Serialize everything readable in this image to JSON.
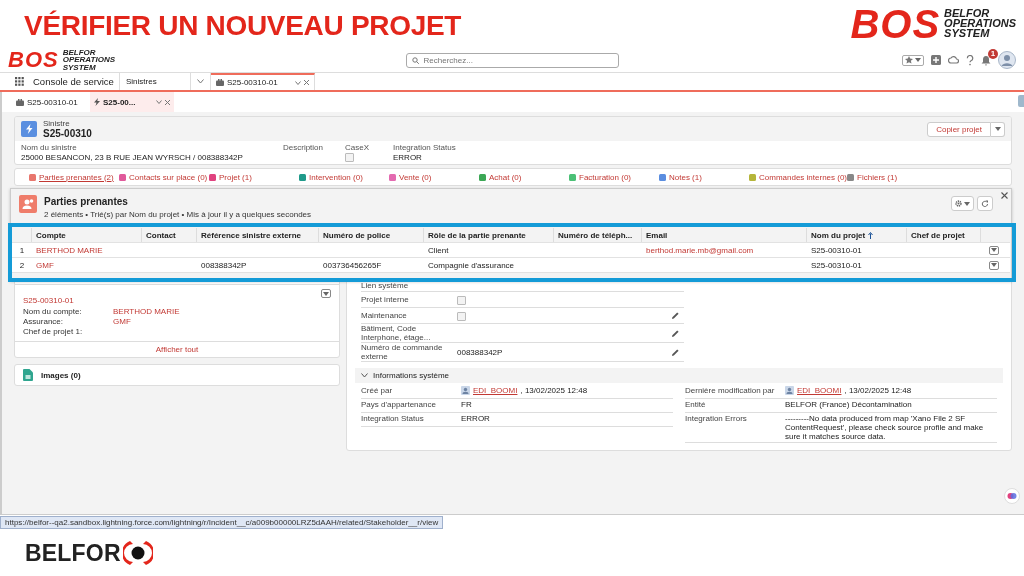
{
  "slide": {
    "title": "VÉRIFIER UN NOUVEAU PROJET",
    "logo": {
      "mark": "BOS",
      "tagline": "BELFOR OPERATIONS SYSTEM"
    },
    "footer_logo": "BELFOR"
  },
  "app": {
    "logo": {
      "mark": "BOS",
      "tagline": "BELFOR OPERATIONS SYSTEM"
    },
    "search": {
      "placeholder": "Recherchez..."
    },
    "notification_badge": "1"
  },
  "nav": {
    "app_name": "Console de service",
    "object_menu": "Sinistres",
    "tabs": [
      {
        "label": "S25-00310-01",
        "selected": true
      }
    ]
  },
  "subtabs": [
    {
      "label": "S25-00310-01",
      "kind": "case",
      "selected": false
    },
    {
      "label": "S25-00...",
      "kind": "incident",
      "selected": true
    }
  ],
  "record": {
    "object": "Sinistre",
    "name": "S25-00310",
    "action": "Copier projet",
    "fields": [
      {
        "label": "Nom du sinistre",
        "kind": "text",
        "value": "25000 BESANCON, 23 B RUE JEAN WYRSCH / 008388342P"
      },
      {
        "label": "Description",
        "kind": "text"
      },
      {
        "label": "CaseX",
        "kind": "checkbox",
        "checked": false
      },
      {
        "label": "Integration Status",
        "kind": "text",
        "value": "ERROR"
      }
    ]
  },
  "related_links": [
    {
      "label": "Parties prenantes (2)",
      "color": "#e8766d",
      "selected": true
    },
    {
      "label": "Contacts sur place (0)",
      "color": "#e05a9b",
      "selected": false
    },
    {
      "label": "Projet (1)",
      "color": "#e0427f",
      "selected": false
    },
    {
      "label": "Intervention (0)",
      "color": "#1f9a8a",
      "selected": false
    },
    {
      "label": "Vente (0)",
      "color": "#e36ab0",
      "selected": false
    },
    {
      "label": "Achat (0)",
      "color": "#3ba755",
      "selected": false
    },
    {
      "label": "Facturation (0)",
      "color": "#4bc076",
      "selected": false
    },
    {
      "label": "Notes (1)",
      "color": "#5a8de0",
      "selected": false
    },
    {
      "label": "Commandes internes (0)",
      "color": "#b5b53a",
      "selected": false
    },
    {
      "label": "Fichiers (1)",
      "color": "#888888",
      "selected": false
    }
  ],
  "popup": {
    "title": "Parties prenantes",
    "subtitle": "2 éléments • Trié(s) par Nom du projet • Mis à jour il y a quelques secondes",
    "columns": [
      {
        "label": "Compte",
        "kind": "link",
        "sorted": false
      },
      {
        "label": "Contact",
        "sorted": false
      },
      {
        "label": "Référence sinistre externe",
        "kind": "text",
        "sorted": false
      },
      {
        "label": "Numéro de police",
        "kind": "text",
        "sorted": false
      },
      {
        "label": "Rôle de la partie prenante",
        "kind": "text",
        "sorted": false
      },
      {
        "label": "Numéro de téléph...",
        "sorted": false
      },
      {
        "label": "Email",
        "kind": "link",
        "sorted": false
      },
      {
        "label": "Nom du projet",
        "kind": "text",
        "sorted": true
      },
      {
        "label": "Chef de projet",
        "sorted": false
      }
    ],
    "rows": [
      {
        "number": "1",
        "cells": [
          "BERTHOD MARIE",
          null,
          null,
          null,
          "Client",
          null,
          "berthod.marie.mb@gmail.com",
          "S25-00310-01",
          null
        ]
      },
      {
        "number": "2",
        "cells": [
          "GMF",
          null,
          "008388342P",
          "003736456265F",
          "Compagnie d'assurance",
          null,
          null,
          "S25-00310-01",
          null
        ]
      }
    ]
  },
  "project_card": {
    "record": "S25-00310-01",
    "fields": [
      {
        "label": "Nom du compte:",
        "value": "BERTHOD MARIE"
      },
      {
        "label": "Assurance:",
        "value": "GMF"
      },
      {
        "label": "Chef de projet 1:"
      }
    ],
    "footer": "Afficher tout"
  },
  "images_card": {
    "title": "Images (0)"
  },
  "details": [
    {
      "label": "Lien système",
      "kind": "text",
      "editable": false
    },
    {
      "label": "Projet interne",
      "kind": "checkbox",
      "checked": false,
      "editable": false
    },
    {
      "label": "Maintenance",
      "kind": "checkbox",
      "checked": false,
      "editable": true
    },
    {
      "label": "Bâtiment, Code Interphone, étage...",
      "kind": "text",
      "editable": true
    },
    {
      "label": "Numéro de commande externe",
      "kind": "text",
      "value": "008388342P",
      "editable": true
    }
  ],
  "system_info": {
    "title": "Informations système",
    "expanded": true,
    "left": [
      {
        "label": "Créé par",
        "user": "EDI_BOOMI",
        "value": ", 13/02/2025 12:48"
      },
      {
        "label": "Pays d'appartenance",
        "value": "FR"
      },
      {
        "label": "Integration Status",
        "value": "ERROR"
      }
    ],
    "right": [
      {
        "label": "Dernière modification par",
        "user": "EDI_BOOMI",
        "value": ", 13/02/2025 12:48"
      },
      {
        "label": "Entité",
        "value": "BELFOR (France) Décontamination"
      },
      {
        "label": "Integration Errors",
        "value": "---------No data produced from map 'Xano File 2 SF ContentRequest', please check source profile and make sure it matches source data."
      }
    ]
  },
  "status_url": "https://belfor--qa2.sandbox.lightning.force.com/lightning/r/Incident__c/a009b00000LRZ5dAAH/related/Stakeholder__r/view"
}
